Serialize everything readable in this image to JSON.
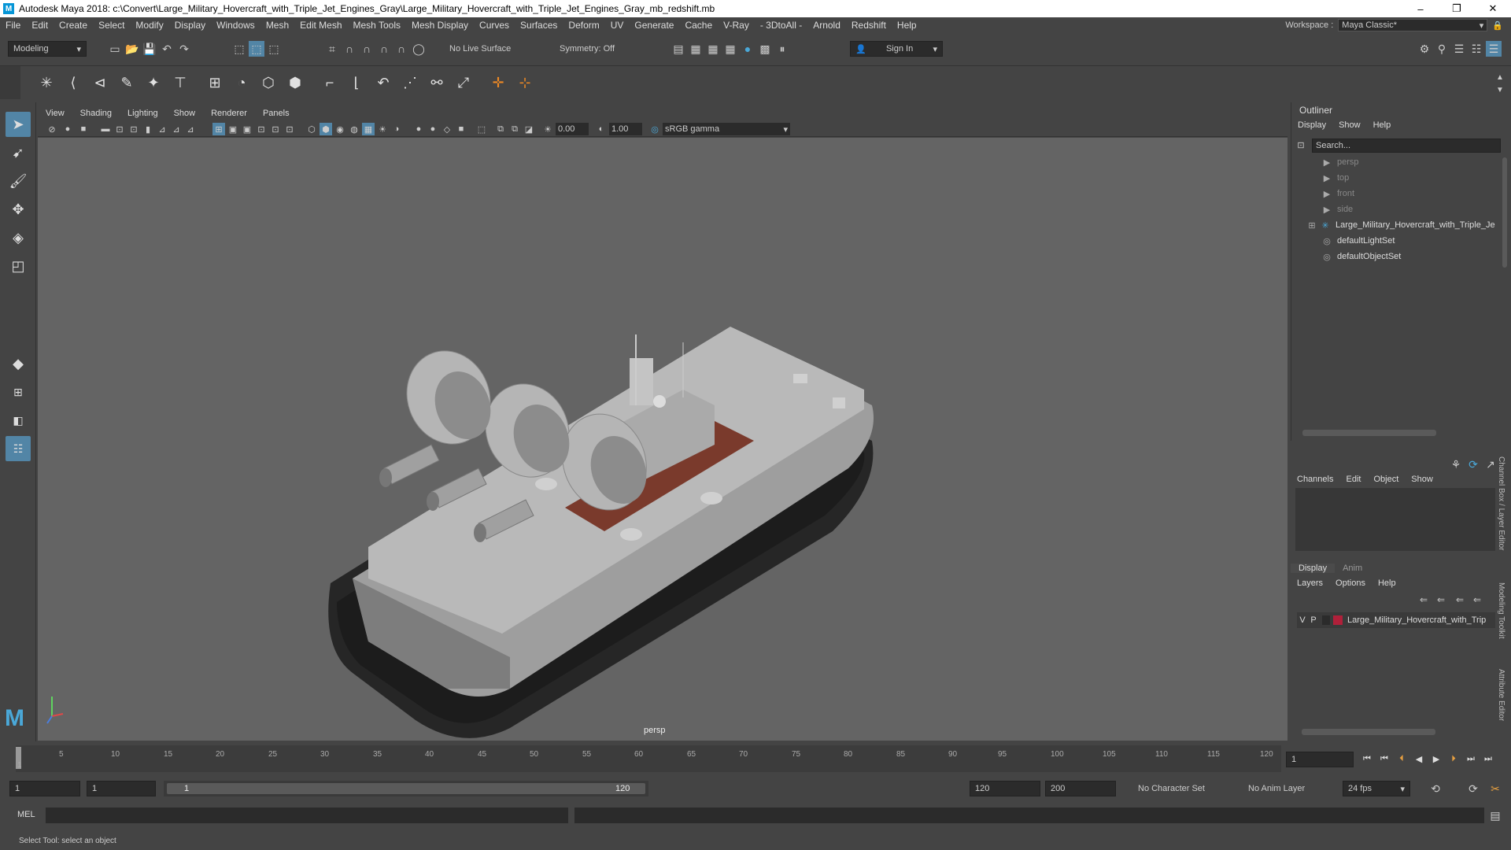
{
  "app": {
    "title": "Autodesk Maya 2018: c:\\Convert\\Large_Military_Hovercraft_with_Triple_Jet_Engines_Gray\\Large_Military_Hovercraft_with_Triple_Jet_Engines_Gray_mb_redshift.mb",
    "logo": "M",
    "win_min": "–",
    "win_max": "❐",
    "win_close": "✕"
  },
  "menus": [
    "File",
    "Edit",
    "Create",
    "Select",
    "Modify",
    "Display",
    "Windows",
    "Mesh",
    "Edit Mesh",
    "Mesh Tools",
    "Mesh Display",
    "Curves",
    "Surfaces",
    "Deform",
    "UV",
    "Generate",
    "Cache",
    "V-Ray",
    "- 3DtoAll -",
    "Arnold",
    "Redshift",
    "Help"
  ],
  "workspace": {
    "label": "Workspace :",
    "value": "Maya Classic*"
  },
  "status": {
    "mode": "Modeling",
    "live_surface": "No Live Surface",
    "symmetry": "Symmetry: Off",
    "sign_in": "Sign In"
  },
  "viewport": {
    "menus": [
      "View",
      "Shading",
      "Lighting",
      "Show",
      "Renderer",
      "Panels"
    ],
    "exposure": "0.00",
    "gamma": "1.00",
    "color_space": "sRGB gamma",
    "camera": "persp"
  },
  "outliner": {
    "title": "Outliner",
    "menus": [
      "Display",
      "Show",
      "Help"
    ],
    "search_placeholder": "Search...",
    "items": [
      {
        "label": "persp",
        "icon": "camera-icon",
        "dim": true
      },
      {
        "label": "top",
        "icon": "camera-icon",
        "dim": true
      },
      {
        "label": "front",
        "icon": "camera-icon",
        "dim": true
      },
      {
        "label": "side",
        "icon": "camera-icon",
        "dim": true
      },
      {
        "label": "Large_Military_Hovercraft_with_Triple_Je",
        "icon": "transform-icon",
        "dim": false
      },
      {
        "label": "defaultLightSet",
        "icon": "set-icon",
        "dim": false
      },
      {
        "label": "defaultObjectSet",
        "icon": "set-icon",
        "dim": false
      }
    ]
  },
  "channel_box": {
    "menus": [
      "Channels",
      "Edit",
      "Object",
      "Show"
    ]
  },
  "layer_editor": {
    "tabs": [
      "Display",
      "Anim"
    ],
    "menus": [
      "Layers",
      "Options",
      "Help"
    ],
    "layer": {
      "v": "V",
      "p": "P",
      "name": "Large_Military_Hovercraft_with_Trip",
      "color": "#b0203a"
    }
  },
  "side_tabs": [
    "Channel Box / Layer Editor",
    "Modeling Toolkit",
    "Attribute Editor"
  ],
  "timeline": {
    "ticks": [
      "5",
      "10",
      "15",
      "20",
      "25",
      "30",
      "35",
      "40",
      "45",
      "50",
      "55",
      "60",
      "65",
      "70",
      "75",
      "80",
      "85",
      "90",
      "95",
      "100",
      "105",
      "110",
      "115",
      "120"
    ],
    "start_marker": "1",
    "current_frame": "1"
  },
  "range": {
    "start": "1",
    "playback_start": "1",
    "slider_start": "1",
    "slider_end": "120",
    "playback_end": "120",
    "end": "200",
    "character_set": "No Character Set",
    "anim_layer": "No Anim Layer",
    "fps": "24 fps"
  },
  "command_line": {
    "label": "MEL"
  },
  "help_line": "Select Tool: select an object",
  "colors": {
    "accent": "#5285a6",
    "maya_blue": "#4aa8d8",
    "deck_red": "#7a3a2c"
  }
}
